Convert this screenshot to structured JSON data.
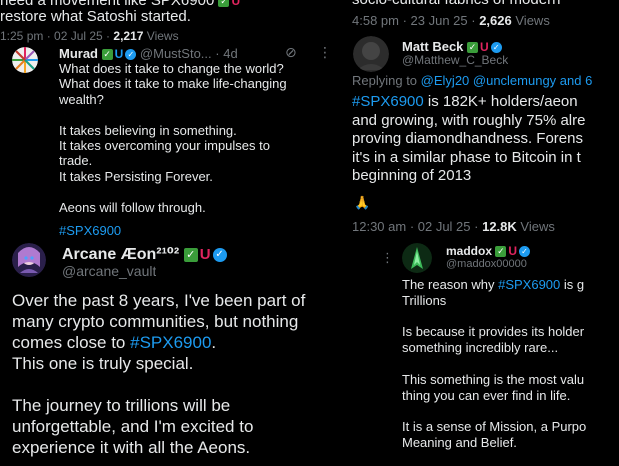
{
  "left": {
    "top_tweet": {
      "text_line1": "need a movement like SPX6900",
      "text_line2": "restore what Satoshi started.",
      "time": "1:25 pm · 02 Jul 25 ·",
      "views_count": "2,217",
      "views_label": "Views"
    },
    "murad": {
      "name": "Murad",
      "handle": "@MustSto...",
      "age": "4d",
      "lines": [
        "What does it take to change the world?",
        "What does it take to make life-changing",
        "wealth?",
        "",
        "It takes believing in something.",
        "It takes overcoming your impulses to",
        "trade.",
        "It takes Persisting Forever.",
        "",
        "Aeons will follow through."
      ],
      "hashtag": "#SPX6900"
    },
    "arcane": {
      "name": "Arcane Æon²¹⁰²",
      "handle": "@arcane_vault",
      "p1_line1": "Over the past 8 years, I've been part of",
      "p1_line2": "many crypto communities, but nothing",
      "p1_line3_pre": "comes close to ",
      "p1_line3_tag": "#SPX6900",
      "p1_line3_post": ".",
      "p1_line4": "This one is truly special.",
      "p2_line1": "The journey to trillions will be",
      "p2_line2": "unforgettable, and I'm excited to",
      "p2_line3": "experience it with all the Aeons."
    }
  },
  "right": {
    "top_tweet": {
      "text": "socio-cultural fabrics of modern",
      "time": "4:58 pm · 23 Jun 25 ·",
      "views_count": "2,626",
      "views_label": "Views"
    },
    "matt": {
      "name": "Matt Beck",
      "handle": "@Matthew_C_Beck",
      "replying_label": "Replying to",
      "replying_to": "@Elyj20 @unclemungy and 6",
      "line1_tag": "#SPX6900",
      "line1_rest": " is 182K+ holders/aeon",
      "line2": "and growing, with roughly 75% alre",
      "line3": "proving diamondhandness. Forens",
      "line4": "it's in a similar phase to Bitcoin in t",
      "line5": "beginning of 2013",
      "emoji": "🙏",
      "time": "12:30 am · 02 Jul 25 ·",
      "views_count": "12.8K",
      "views_label": "Views"
    },
    "maddox": {
      "name": "maddox",
      "handle": "@maddox00000",
      "line1_pre": "The reason why ",
      "line1_tag": "#SPX6900",
      "line1_post": " is g",
      "line2": "Trillions",
      "line3": "Is because it provides its holder",
      "line4": "something incredibly rare...",
      "line5": "This something is the most valu",
      "line6": "thing you can ever find in life.",
      "line7": "It is a sense of Mission, a Purpo",
      "line8": "Meaning and Belief."
    }
  },
  "icons": {
    "badge_check": "✓",
    "badge_magnet": "U",
    "verified": "✓",
    "grok": "⊘",
    "more": "⋮"
  },
  "colors": {
    "background": "#000000",
    "text": "#e7e9ea",
    "muted": "#71767b",
    "link": "#1d9bf0"
  }
}
